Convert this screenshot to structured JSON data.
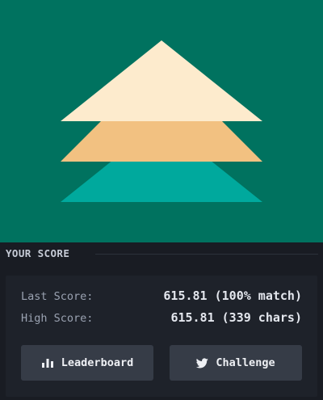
{
  "artwork": {
    "background_color": "#00725f",
    "shapes": [
      {
        "name": "bottom-teal-triangle",
        "color": "#00a99d"
      },
      {
        "name": "middle-orange-trapezoid",
        "color": "#f2c181"
      },
      {
        "name": "top-cream-triangle",
        "color": "#fdebcd"
      }
    ]
  },
  "score_section": {
    "title": "YOUR SCORE",
    "last_score_label": "Last Score:",
    "last_score_value": "615.81 (100% match)",
    "high_score_label": "High Score:",
    "high_score_value": "615.81 (339 chars)"
  },
  "actions": {
    "leaderboard_label": "Leaderboard",
    "leaderboard_icon": "bar-chart-icon",
    "challenge_label": "Challenge",
    "challenge_icon": "twitter-icon"
  }
}
